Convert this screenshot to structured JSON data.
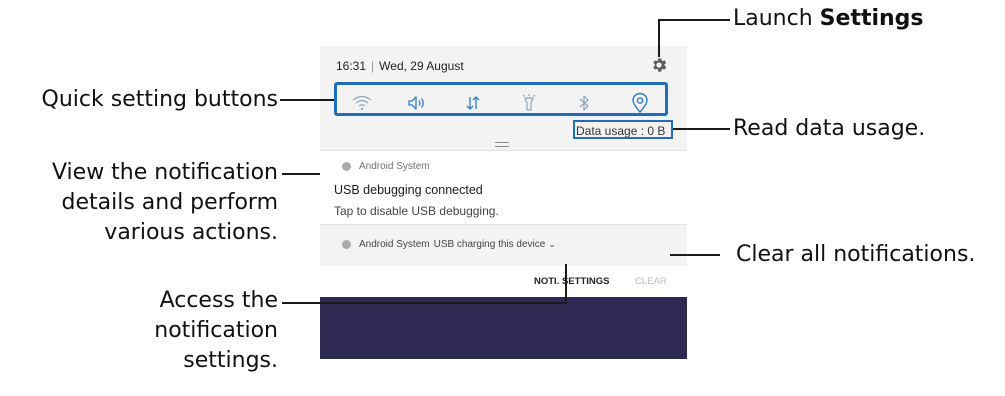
{
  "status": {
    "time": "16:31",
    "separator": "|",
    "date": "Wed, 29 August"
  },
  "quick_settings": {
    "buttons": [
      "wifi",
      "sound",
      "mobile-data",
      "flashlight",
      "bluetooth",
      "location"
    ],
    "data_usage": "Data usage : 0 B"
  },
  "notifications": [
    {
      "app": "Android System",
      "title": "USB debugging connected",
      "text": "Tap to disable USB debugging."
    },
    {
      "app": "Android System",
      "summary": "USB charging this device"
    }
  ],
  "actions": {
    "noti_settings": "NOTI. SETTINGS",
    "clear": "CLEAR"
  },
  "callouts": {
    "launch_settings_prefix": "Launch ",
    "launch_settings_bold": "Settings",
    "quick_setting_buttons": "Quick setting buttons",
    "read_data_usage": "Read data usage.",
    "view_details_line1": "View the notification",
    "view_details_line2": "details and perform",
    "view_details_line3": "various actions.",
    "clear_all": "Clear all notifications.",
    "access_settings_line1": "Access the",
    "access_settings_line2": "notification",
    "access_settings_line3": "settings."
  },
  "colors": {
    "callout_frame": "#1d6fbe",
    "quick_icon": "#2f7bd0",
    "wallpaper": "#2e2953"
  }
}
